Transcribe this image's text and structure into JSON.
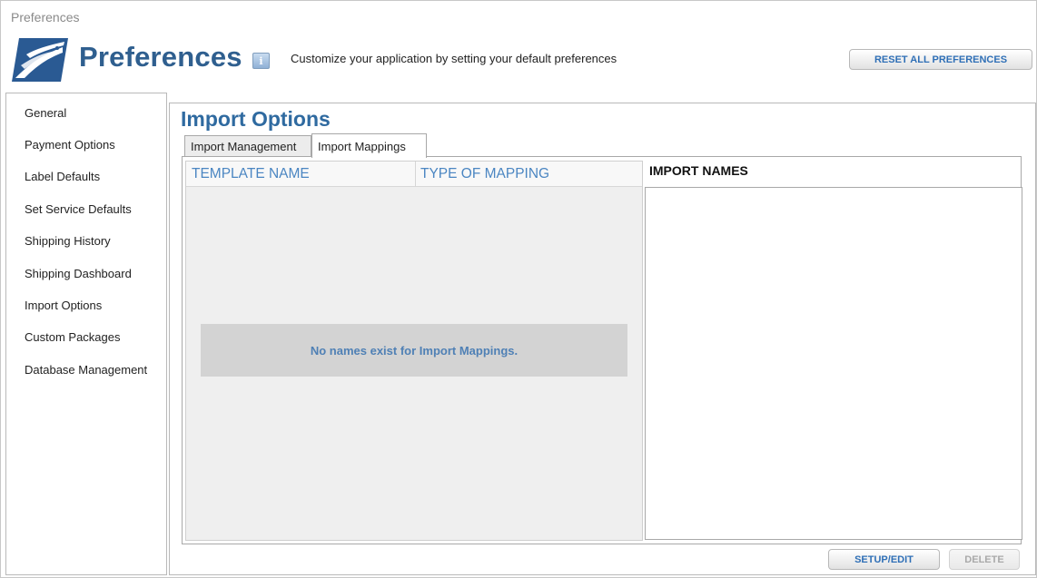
{
  "window": {
    "title": "Preferences"
  },
  "header": {
    "title": "Preferences",
    "subtitle": "Customize your application by setting your default preferences",
    "info_icon": "info-icon",
    "reset_label": "RESET ALL PREFERENCES",
    "logo_icon": "eagle-logo-icon",
    "brand_color": "#2f5f8f"
  },
  "sidebar": {
    "items": [
      {
        "label": "General"
      },
      {
        "label": "Payment Options"
      },
      {
        "label": "Label Defaults"
      },
      {
        "label": "Set Service Defaults"
      },
      {
        "label": "Shipping History"
      },
      {
        "label": "Shipping Dashboard"
      },
      {
        "label": "Import Options"
      },
      {
        "label": "Custom Packages"
      },
      {
        "label": "Database Management"
      }
    ]
  },
  "main": {
    "title": "Import Options",
    "tabs": [
      {
        "label": "Import Management",
        "active": false
      },
      {
        "label": "Import Mappings",
        "active": true
      }
    ],
    "grid": {
      "columns": [
        "TEMPLATE NAME",
        "TYPE OF MAPPING"
      ],
      "rows": [],
      "empty_message": "No names exist for Import Mappings."
    },
    "import_names": {
      "title": "IMPORT NAMES",
      "items": []
    },
    "buttons": {
      "setup_edit": "SETUP/EDIT",
      "delete": "DELETE"
    }
  }
}
